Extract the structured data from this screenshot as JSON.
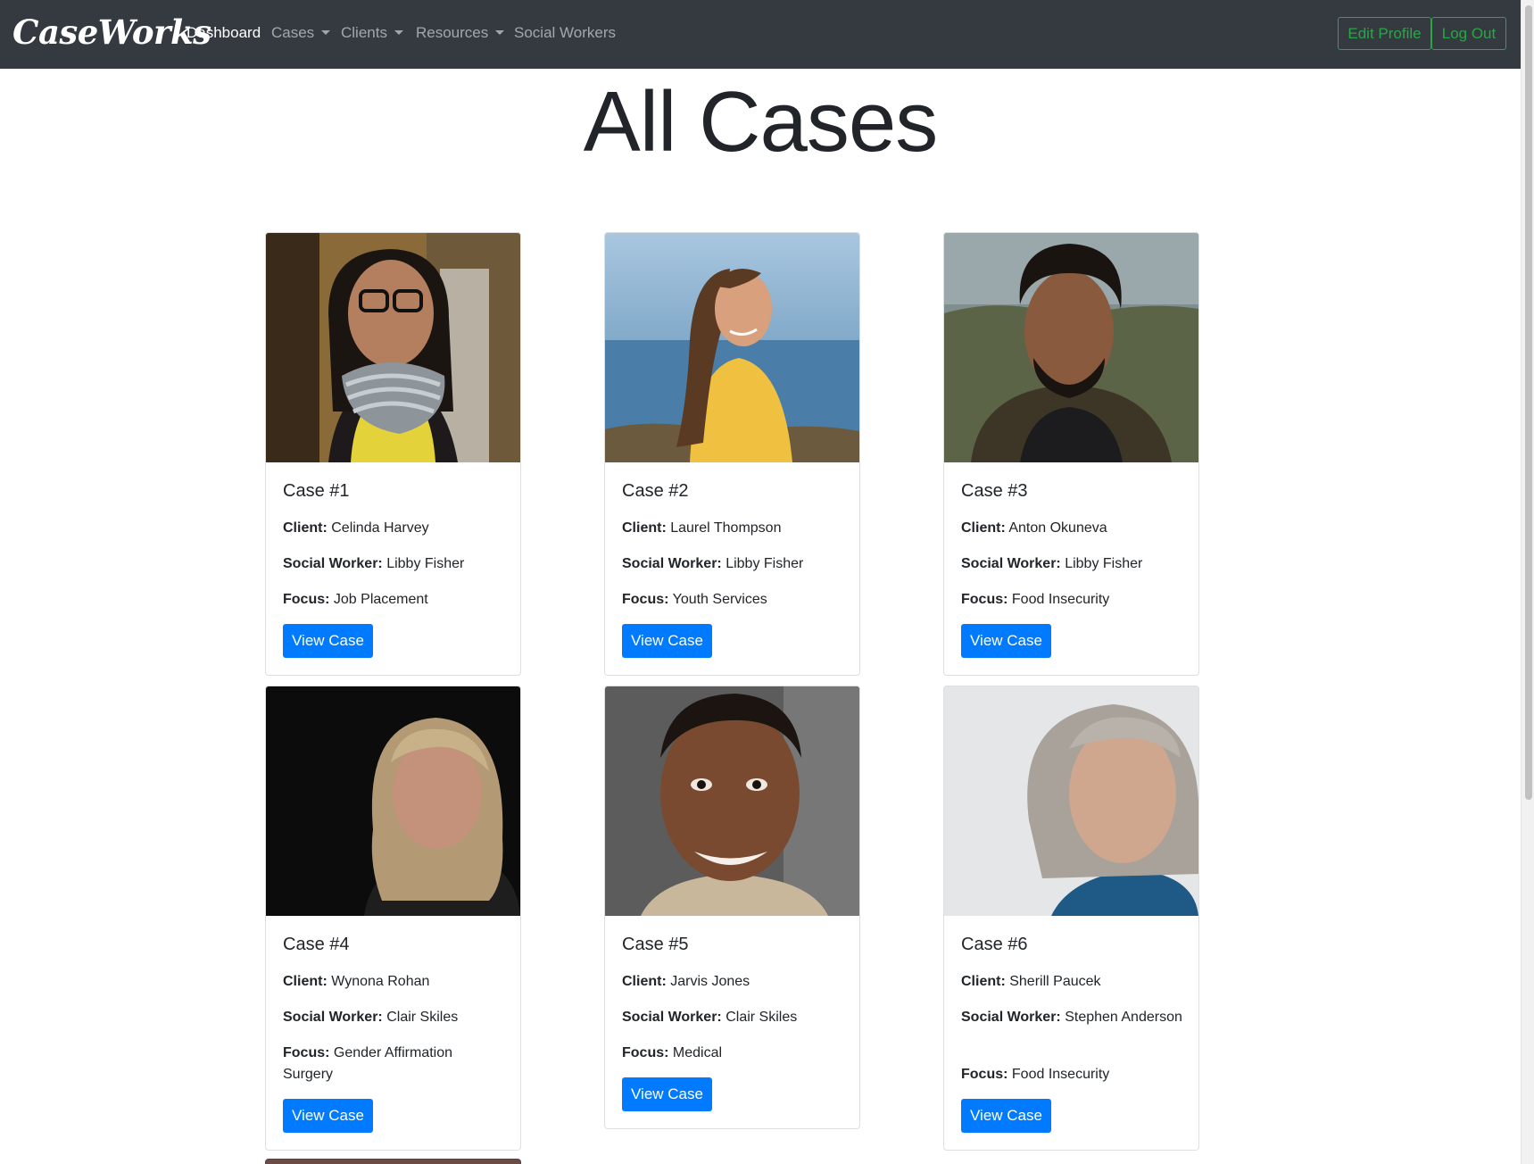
{
  "navbar": {
    "brand": "CaseWorks",
    "items": [
      {
        "label": "Dashboard",
        "active": true,
        "dropdown": false
      },
      {
        "label": "Cases",
        "active": false,
        "dropdown": true
      },
      {
        "label": "Clients",
        "active": false,
        "dropdown": true
      },
      {
        "label": "Resources",
        "active": false,
        "dropdown": true
      },
      {
        "label": "Social Workers",
        "active": false,
        "dropdown": false
      }
    ],
    "edit_profile": "Edit Profile",
    "log_out": "Log Out"
  },
  "page": {
    "title": "All Cases"
  },
  "labels": {
    "client": "Client:",
    "social_worker": "Social Worker:",
    "focus": "Focus:",
    "view_button": "View Case"
  },
  "cases": [
    {
      "title": "Case #1",
      "client": "Celinda Harvey",
      "social_worker": "Libby Fisher",
      "focus": "Job Placement"
    },
    {
      "title": "Case #2",
      "client": "Laurel Thompson",
      "social_worker": "Libby Fisher",
      "focus": "Youth Services"
    },
    {
      "title": "Case #3",
      "client": "Anton Okuneva",
      "social_worker": "Libby Fisher",
      "focus": "Food Insecurity"
    },
    {
      "title": "Case #4",
      "client": "Wynona Rohan",
      "social_worker": "Clair Skiles",
      "focus": "Gender Affirmation Surgery"
    },
    {
      "title": "Case #5",
      "client": "Jarvis Jones",
      "social_worker": "Clair Skiles",
      "focus": "Medical"
    },
    {
      "title": "Case #6",
      "client": "Sherill Paucek",
      "social_worker": "Stephen Anderson",
      "focus": "Food Insecurity"
    }
  ],
  "colors": {
    "navbar_bg": "#343a40",
    "primary": "#007bff",
    "success": "#28a745"
  }
}
